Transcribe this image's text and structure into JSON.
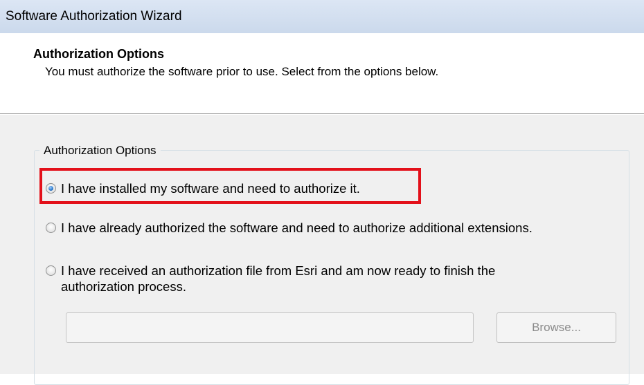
{
  "window": {
    "title": "Software Authorization Wizard"
  },
  "header": {
    "title": "Authorization Options",
    "subtitle": "You must authorize the software prior to use. Select from the options below."
  },
  "options_group": {
    "legend": "Authorization Options",
    "options": [
      {
        "label": "I have installed my software and need to authorize it.",
        "selected": true,
        "highlighted": true
      },
      {
        "label": "I have already authorized the software and need to authorize additional extensions.",
        "selected": false,
        "highlighted": false
      },
      {
        "label_line1": "I have received an authorization file from Esri and am now ready to finish the",
        "label_line2": "authorization process.",
        "selected": false,
        "highlighted": false
      }
    ],
    "file_path": {
      "value": "",
      "placeholder": ""
    },
    "browse_label": "Browse..."
  },
  "colors": {
    "highlight": "#e3101a",
    "titlebar": "#dce6f4",
    "panel_bg": "#f0f0f0"
  }
}
